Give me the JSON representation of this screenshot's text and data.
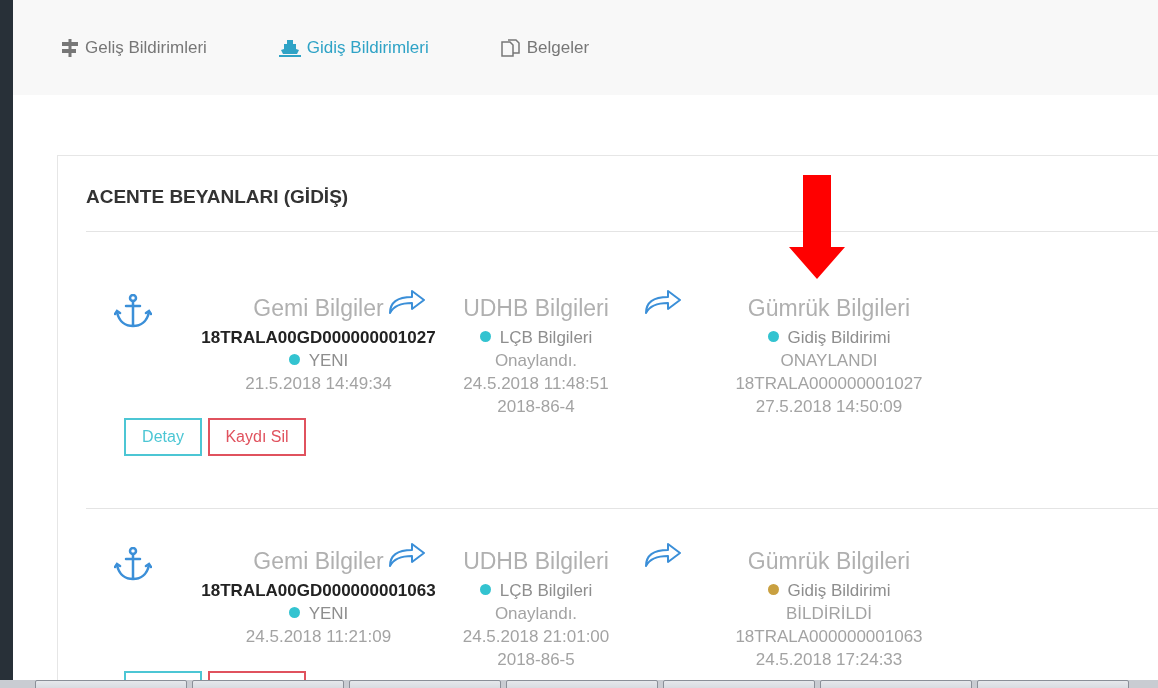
{
  "nav": [
    {
      "label": "Geliş Bildirimleri",
      "selected": false,
      "kind": "signpost"
    },
    {
      "label": "Gidiş Bildirimleri",
      "selected": true,
      "kind": "ship"
    },
    {
      "label": "Belgeler",
      "selected": false,
      "kind": "documents"
    }
  ],
  "panel": {
    "title": "ACENTE BEYANLARI (GİDİŞ)",
    "records": [
      {
        "ship": {
          "heading": "Gemi Bilgiler",
          "number": "18TRALA00GD000000001027",
          "status": "YENI",
          "color": "#33c3d0",
          "date": "21.5.2018 14:49:34"
        },
        "udhb": {
          "heading": "UDHB Bilgileri",
          "status": "LÇB Bilgileri",
          "color": "#33c3d0",
          "lines": [
            "Onaylandı.",
            "24.5.2018 11:48:51",
            "2018-86-4"
          ]
        },
        "customs": {
          "heading": "Gümrük Bilgileri",
          "status": "Gidiş Bildirimi",
          "color": "#33c3d0",
          "lines": [
            "ONAYLANDI",
            "18TRALA000000001027",
            "27.5.2018 14:50:09"
          ]
        },
        "buttons": [
          {
            "kind": "info",
            "label": "Detay"
          },
          {
            "kind": "danger",
            "label": "Kaydı Sil"
          }
        ]
      },
      {
        "ship": {
          "heading": "Gemi Bilgiler",
          "number": "18TRALA00GD000000001063",
          "status": "YENI",
          "color": "#33c3d0",
          "date": "24.5.2018 11:21:09"
        },
        "udhb": {
          "heading": "UDHB Bilgileri",
          "status": "LÇB Bilgileri",
          "color": "#33c3d0",
          "lines": [
            "Onaylandı.",
            "24.5.2018 21:01:00",
            "2018-86-5"
          ]
        },
        "customs": {
          "heading": "Gümrük Bilgileri",
          "status": "Gidiş Bildirimi",
          "color": "#c9a040",
          "lines": [
            "BİLDİRİLDİ",
            "18TRALA000000001063",
            "24.5.2018 17:24:33"
          ]
        },
        "buttons": [
          {
            "kind": "info"
          },
          {
            "kind": "danger"
          }
        ]
      }
    ]
  }
}
